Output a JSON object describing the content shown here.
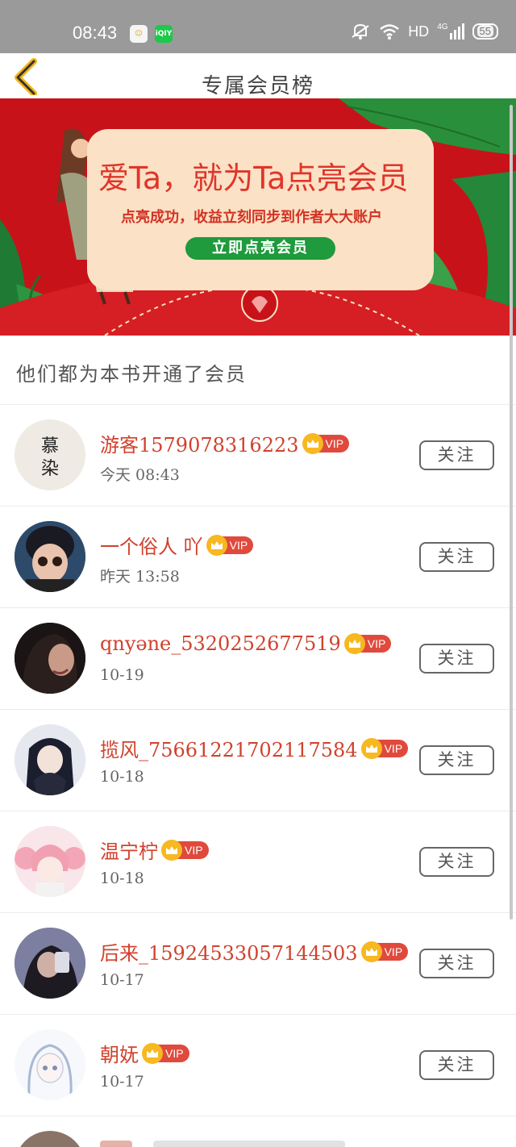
{
  "status_bar": {
    "time": "08:43",
    "app_icons": [
      "chat-notify-icon",
      "iqiyi-icon"
    ],
    "app_icon_labels": [
      "☺",
      "iQIY"
    ],
    "network": "HD",
    "signal": "4G",
    "battery": "55"
  },
  "header": {
    "title": "专属会员榜",
    "back_icon": "back-chevron-icon"
  },
  "banner": {
    "headline": "爱Ta，就为Ta点亮会员",
    "subtext": "点亮成功，收益立刻同步到作者大大账户",
    "cta": "立即点亮会员",
    "colors": {
      "background": "#c8121a",
      "card": "#fbe1c5",
      "cta": "#1f9a3c"
    }
  },
  "section": {
    "title": "他们都为本书开通了会员"
  },
  "members": [
    {
      "name": "游客1579078316223",
      "time": "今天 08:43",
      "badge": "VIP",
      "follow": "关注",
      "avatar": "calligraphy-avatar"
    },
    {
      "name": "一个俗人 吖",
      "time": "昨天 13:58",
      "badge": "VIP",
      "follow": "关注",
      "avatar": "cartoon-boy-avatar"
    },
    {
      "name": "qnyəne_5320252677519",
      "time": "10-19",
      "badge": "VIP",
      "follow": "关注",
      "avatar": "dark-portrait-avatar"
    },
    {
      "name": "揽风_75661221702117584",
      "time": "10-18",
      "badge": "VIP",
      "follow": "关注",
      "avatar": "anime-girl-avatar"
    },
    {
      "name": "温宁柠",
      "time": "10-18",
      "badge": "VIP",
      "follow": "关注",
      "avatar": "pink-anime-avatar"
    },
    {
      "name": "后来_15924533057144503",
      "time": "10-17",
      "badge": "VIP",
      "follow": "关注",
      "avatar": "dark-selfie-avatar"
    },
    {
      "name": "朝妩",
      "time": "10-17",
      "badge": "VIP",
      "follow": "关注",
      "avatar": "sketch-anime-avatar"
    }
  ],
  "colors": {
    "name": "#d0422e",
    "vip": "#e04a3c",
    "crown": "#f7b820"
  }
}
